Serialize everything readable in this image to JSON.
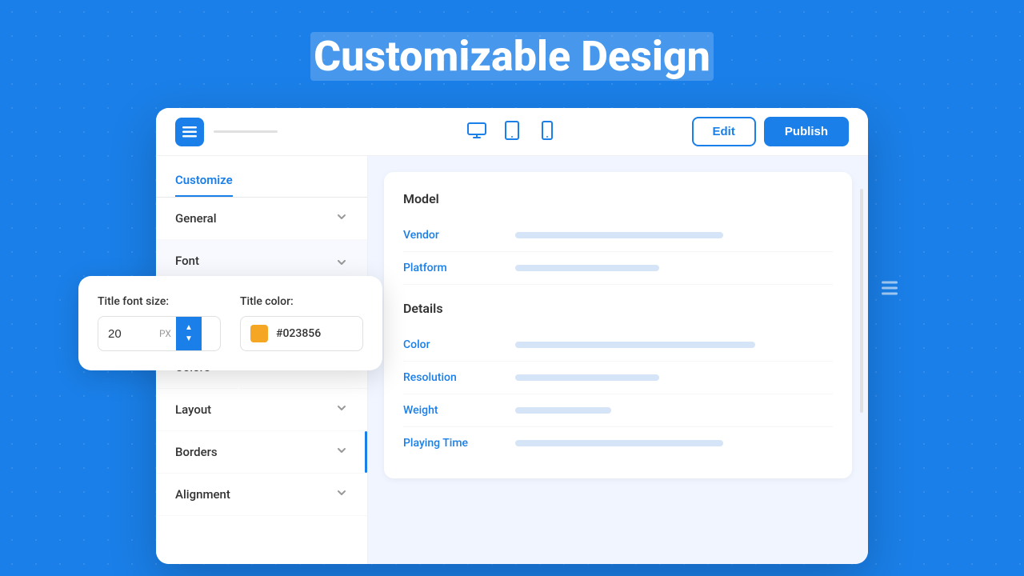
{
  "page": {
    "title": "Customizable Design",
    "title_highlight": "Design"
  },
  "toolbar": {
    "edit_label": "Edit",
    "publish_label": "Publish"
  },
  "sidebar": {
    "active_tab": "Customize",
    "items": [
      {
        "label": "General",
        "expanded": false
      },
      {
        "label": "Font",
        "expanded": true
      },
      {
        "label": "Colors",
        "expanded": false
      },
      {
        "label": "Layout",
        "expanded": false
      },
      {
        "label": "Borders",
        "expanded": false
      },
      {
        "label": "Alignment",
        "expanded": false
      }
    ]
  },
  "font_popup": {
    "title_font_size_label": "Title font size:",
    "font_size_value": "20",
    "font_size_unit": "PX",
    "title_color_label": "Title color:",
    "color_hex": "#023856"
  },
  "main_panel": {
    "sections": [
      {
        "title": "Model",
        "fields": [
          {
            "label": "Vendor",
            "bar_class": "long"
          },
          {
            "label": "Platform",
            "bar_class": "medium"
          }
        ]
      },
      {
        "title": "Details",
        "fields": [
          {
            "label": "Color",
            "bar_class": "xlong"
          },
          {
            "label": "Resolution",
            "bar_class": "medium"
          },
          {
            "label": "Weight",
            "bar_class": "short"
          },
          {
            "label": "Playing Time",
            "bar_class": "long"
          }
        ]
      }
    ]
  },
  "icons": {
    "menu": "☰",
    "desktop": "🖥",
    "tablet": "📱",
    "mobile": "📱",
    "chevron_down": "∨",
    "chevron_up": "∧"
  }
}
